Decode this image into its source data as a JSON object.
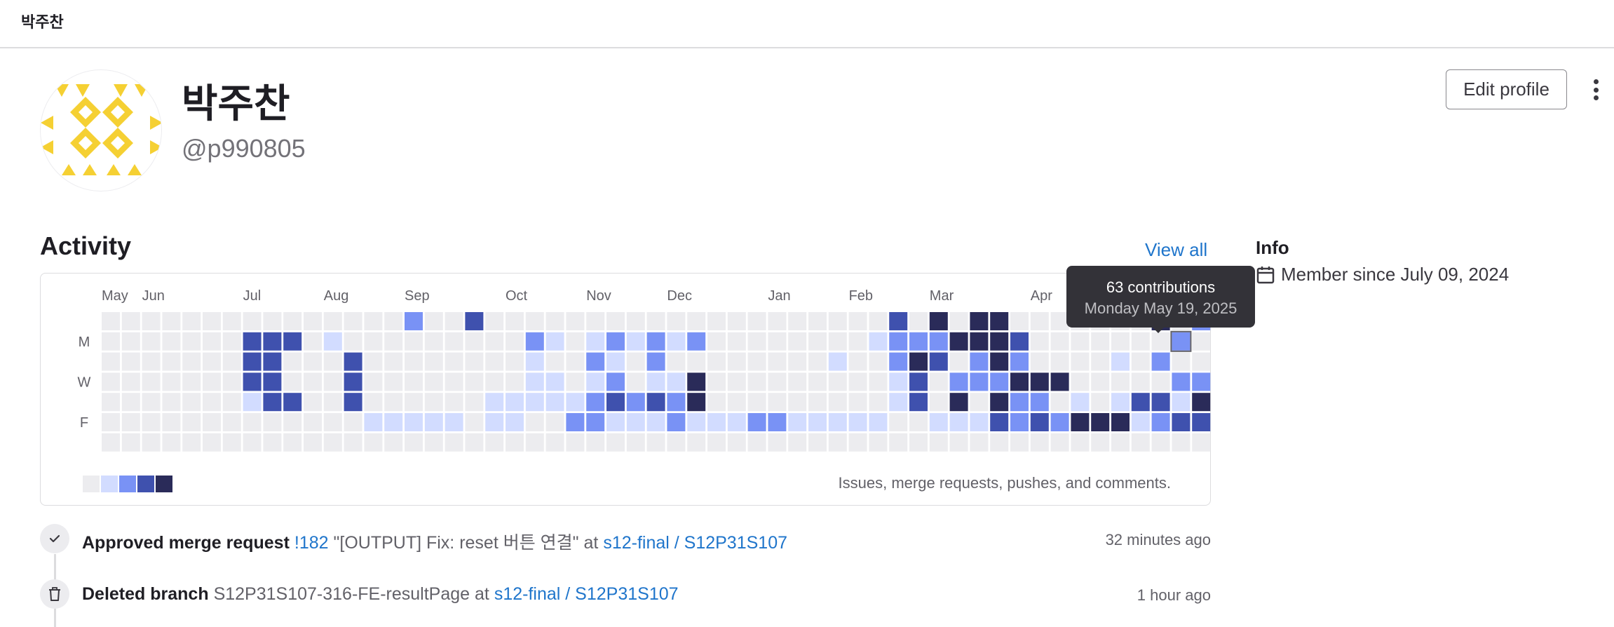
{
  "topbar": {
    "title": "박주찬"
  },
  "profile": {
    "name": "박주찬",
    "username": "@p990805",
    "edit_label": "Edit profile"
  },
  "activity": {
    "title": "Activity",
    "view_all": "View all",
    "months": [
      "May",
      "Jun",
      "Jul",
      "Aug",
      "Sep",
      "Oct",
      "Nov",
      "Dec",
      "Jan",
      "Feb",
      "Mar",
      "Apr"
    ],
    "month_start_week": [
      0,
      2,
      7,
      11,
      15,
      20,
      24,
      28,
      33,
      37,
      41,
      46
    ],
    "day_labels": [
      "",
      "M",
      "",
      "W",
      "",
      "F",
      ""
    ],
    "legend_text": "Issues, merge requests, pushes, and comments.",
    "levels": [
      "0000000000000002003000000000000000000003040440000000402010300",
      "0000000333010000000002101212120000000012224443000000020213314",
      "0000000330003000000001002102000000001002430242000010200000442",
      "0000000330003000000001101201140000000001302224440000022320124",
      "0000000133003000000111112323240000000001304042201013314300144",
      "0000000000000111110110022111211122111110011132324441233201143",
      "0000000000000000000000000000000000000000000000000000000000000"
    ],
    "palette": [
      "#ececef",
      "#d2dcff",
      "#7992f5",
      "#3f51ae",
      "#2a2b59"
    ],
    "tooltip": {
      "contributions": "63 contributions",
      "date": "Monday May 19, 2025"
    }
  },
  "info": {
    "title": "Info",
    "member_since": "Member since July 09, 2024"
  },
  "events": [
    {
      "action": "Approved merge request",
      "ref": "!182",
      "detail": "\"[OUTPUT] Fix: reset 버튼 연결\"",
      "at": "at",
      "project": "s12-final / S12P31S107",
      "time": "32 minutes ago"
    },
    {
      "action": "Deleted branch",
      "ref": "",
      "detail": "S12P31S107-316-FE-resultPage",
      "at": "at",
      "project": "s12-final / S12P31S107",
      "time": "1 hour ago"
    }
  ],
  "icons": {
    "check": "check-icon",
    "trash": "trash-icon",
    "calendar": "calendar-icon",
    "kebab": "kebab-icon"
  }
}
